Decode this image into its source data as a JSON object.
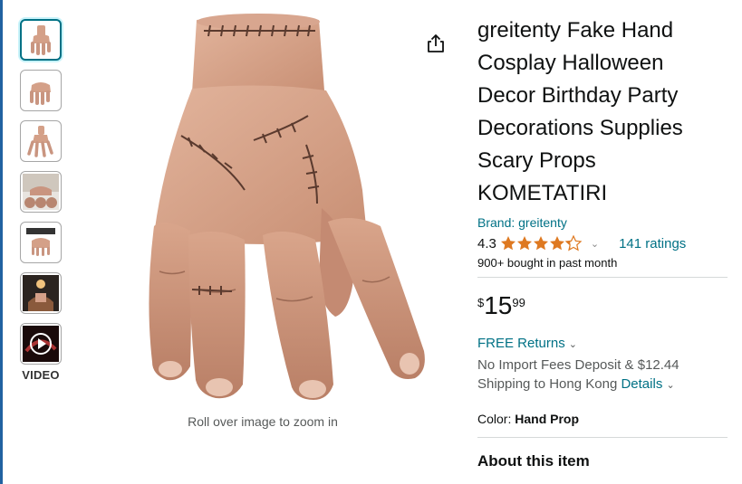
{
  "thumbnails": {
    "items": [
      {
        "icon": "hand-thumbnail-1",
        "selected": true
      },
      {
        "icon": "hand-thumbnail-2"
      },
      {
        "icon": "hand-thumbnail-3"
      },
      {
        "icon": "hand-thumbnail-4"
      },
      {
        "icon": "hand-thumbnail-5"
      },
      {
        "icon": "hand-thumbnail-6"
      },
      {
        "icon": "video-thumbnail"
      }
    ],
    "video_label": "VIDEO"
  },
  "main_image": {
    "icon": "fake-hand-image",
    "zoom_hint": "Roll over image to zoom in"
  },
  "share": {
    "icon": "share-icon"
  },
  "product": {
    "title": "greitenty Fake Hand Cosplay Halloween Decor Birthday Party Decorations Supplies Scary Props KOMETATIRI",
    "brand": "Brand: greitenty",
    "rating": "4.3",
    "rating_value": 4.3,
    "ratings_count": "141 ratings",
    "bought": "900+ bought in past month",
    "price": {
      "symbol": "$",
      "whole": "15",
      "fraction": "99"
    },
    "returns": "FREE Returns",
    "fees": "No Import Fees Deposit & $12.44",
    "shipping": "Shipping to Hong Kong",
    "details_link": "Details",
    "color_label": "Color:",
    "color_value": "Hand Prop",
    "about": "About this item"
  },
  "colors": {
    "link": "#007185",
    "star": "#de7921",
    "text": "#0f1111",
    "secondary": "#565959",
    "divider": "#d5d9d9",
    "selected_thumb": "#007185"
  }
}
